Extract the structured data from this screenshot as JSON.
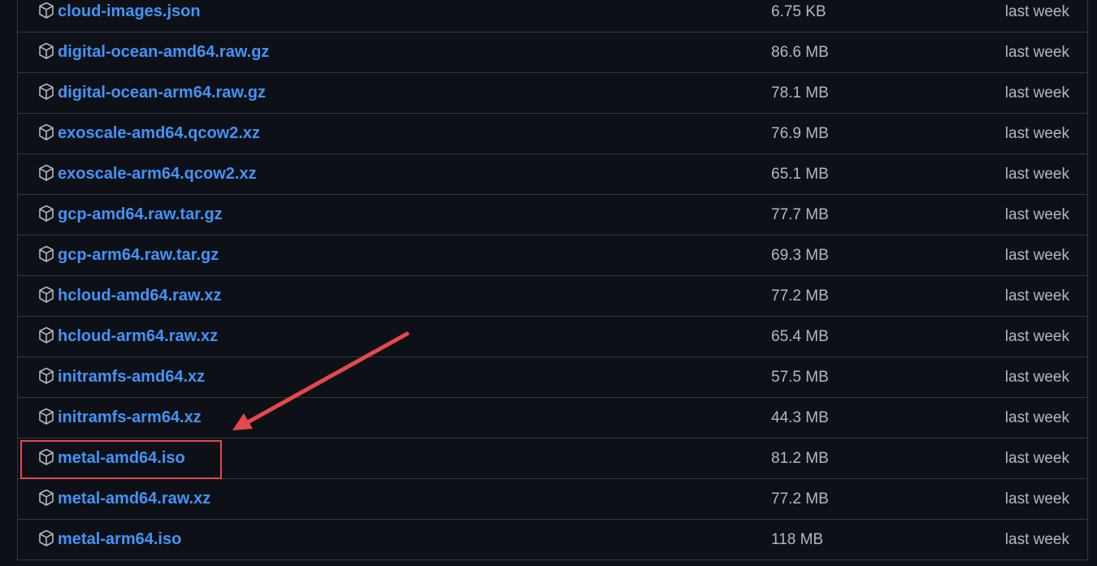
{
  "assets": [
    {
      "name": "cloud-images.json",
      "size": "6.75 KB",
      "date": "last week",
      "icon": "package-icon"
    },
    {
      "name": "digital-ocean-amd64.raw.gz",
      "size": "86.6 MB",
      "date": "last week",
      "icon": "package-icon"
    },
    {
      "name": "digital-ocean-arm64.raw.gz",
      "size": "78.1 MB",
      "date": "last week",
      "icon": "package-icon"
    },
    {
      "name": "exoscale-amd64.qcow2.xz",
      "size": "76.9 MB",
      "date": "last week",
      "icon": "package-icon"
    },
    {
      "name": "exoscale-arm64.qcow2.xz",
      "size": "65.1 MB",
      "date": "last week",
      "icon": "package-icon"
    },
    {
      "name": "gcp-amd64.raw.tar.gz",
      "size": "77.7 MB",
      "date": "last week",
      "icon": "package-icon"
    },
    {
      "name": "gcp-arm64.raw.tar.gz",
      "size": "69.3 MB",
      "date": "last week",
      "icon": "package-icon"
    },
    {
      "name": "hcloud-amd64.raw.xz",
      "size": "77.2 MB",
      "date": "last week",
      "icon": "package-icon"
    },
    {
      "name": "hcloud-arm64.raw.xz",
      "size": "65.4 MB",
      "date": "last week",
      "icon": "package-icon"
    },
    {
      "name": "initramfs-amd64.xz",
      "size": "57.5 MB",
      "date": "last week",
      "icon": "package-icon"
    },
    {
      "name": "initramfs-arm64.xz",
      "size": "44.3 MB",
      "date": "last week",
      "icon": "package-icon"
    },
    {
      "name": "metal-amd64.iso",
      "size": "81.2 MB",
      "date": "last week",
      "icon": "package-icon"
    },
    {
      "name": "metal-amd64.raw.xz",
      "size": "77.2 MB",
      "date": "last week",
      "icon": "package-icon"
    },
    {
      "name": "metal-arm64.iso",
      "size": "118 MB",
      "date": "last week",
      "icon": "package-icon"
    }
  ],
  "colors": {
    "background": "#0d1117",
    "border": "#30363d",
    "link": "#4493f8",
    "muted_text": "#b1b8c0",
    "annotation": "#e5484d"
  }
}
